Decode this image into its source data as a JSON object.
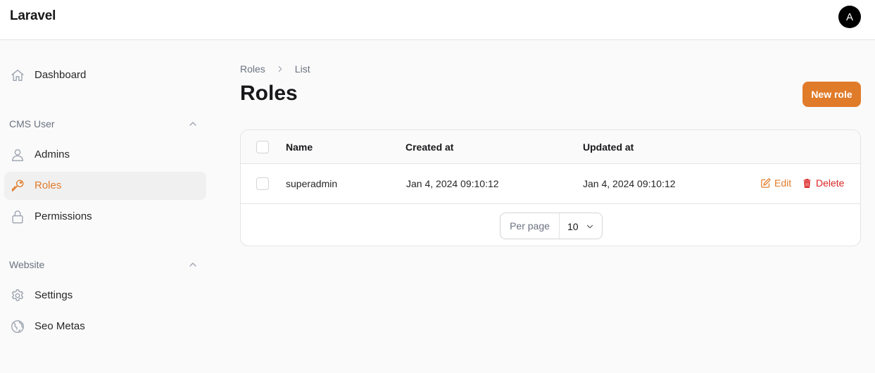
{
  "app": {
    "brand": "Laravel",
    "user_initial": "A"
  },
  "sidebar": {
    "items": [
      {
        "label": "Dashboard",
        "icon": "home-icon"
      },
      {
        "label": "Admins",
        "icon": "user-icon"
      },
      {
        "label": "Roles",
        "icon": "key-icon",
        "active": true
      },
      {
        "label": "Permissions",
        "icon": "lock-icon"
      },
      {
        "label": "Settings",
        "icon": "gear-icon"
      },
      {
        "label": "Seo Metas",
        "icon": "globe-icon"
      }
    ],
    "groups": [
      {
        "label": "CMS User"
      },
      {
        "label": "Website"
      }
    ]
  },
  "breadcrumb": {
    "items": [
      "Roles",
      "List"
    ]
  },
  "page": {
    "title": "Roles",
    "new_button": "New role"
  },
  "table": {
    "columns": [
      "Name",
      "Created at",
      "Updated at"
    ],
    "rows": [
      {
        "name": "superadmin",
        "created_at": "Jan 4, 2024 09:10:12",
        "updated_at": "Jan 4, 2024 09:10:12",
        "edit": "Edit",
        "delete": "Delete"
      }
    ]
  },
  "pagination": {
    "label": "Per page",
    "value": "10"
  },
  "colors": {
    "accent": "#e07b2a",
    "danger": "#dc2626"
  }
}
